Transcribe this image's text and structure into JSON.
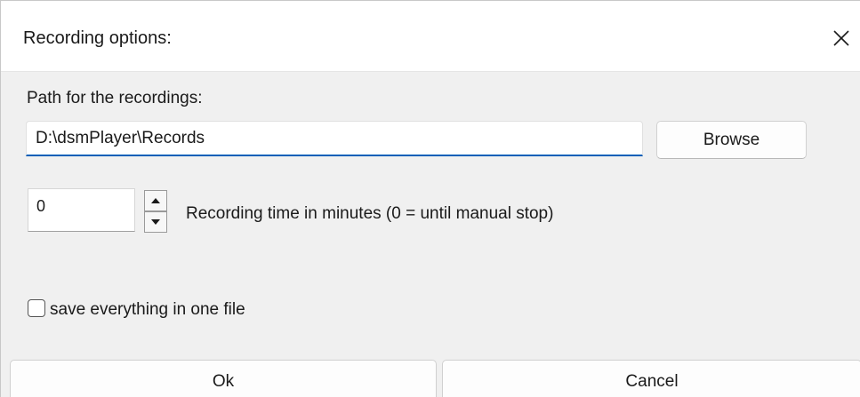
{
  "dialog": {
    "title": "Recording options:"
  },
  "path": {
    "label": "Path for the recordings:",
    "value": "D:\\dsmPlayer\\Records",
    "browse_label": "Browse"
  },
  "recording_time": {
    "value": "0",
    "label": "Recording time in minutes (0 = until manual stop)"
  },
  "single_file": {
    "label": "save everything in one file",
    "checked": false
  },
  "buttons": {
    "ok_label": "Ok",
    "cancel_label": "Cancel"
  },
  "icons": {
    "close": "close-icon",
    "spin_up": "triangle-up-icon",
    "spin_down": "triangle-down-icon"
  },
  "colors": {
    "accent": "#005fb8",
    "dialog_background": "#f0f0f0",
    "titlebar_background": "#ffffff"
  }
}
